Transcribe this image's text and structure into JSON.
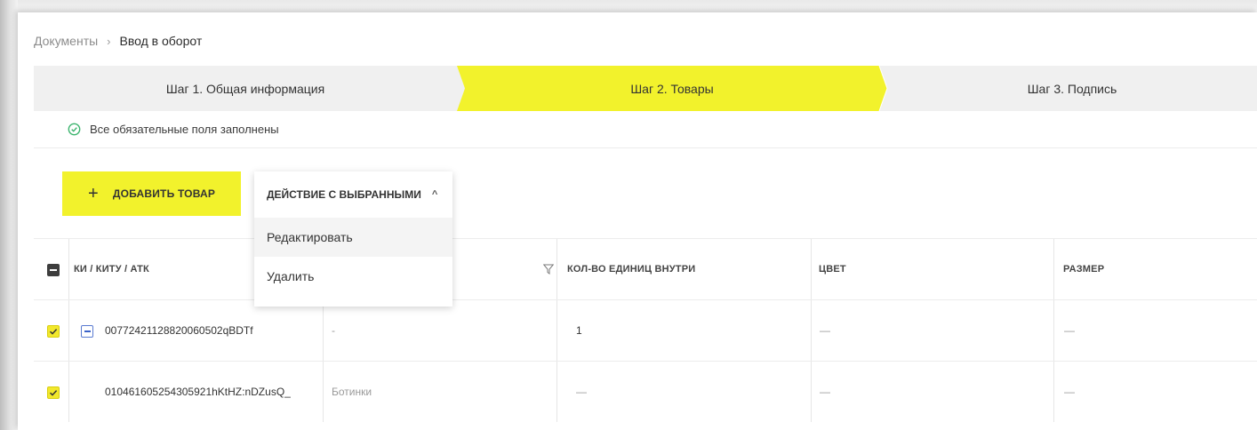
{
  "breadcrumb": {
    "root": "Документы",
    "separator": "›",
    "current": "Ввод в оборот"
  },
  "steps": [
    {
      "label": "Шаг 1. Общая информация",
      "active": false
    },
    {
      "label": "Шаг 2. Товары",
      "active": true
    },
    {
      "label": "Шаг 3. Подпись",
      "active": false
    }
  ],
  "status": {
    "text": "Все обязательные поля заполнены",
    "icon": "check-circle-icon"
  },
  "toolbar": {
    "add_label": "ДОБАВИТЬ ТОВАР",
    "add_icon": "+",
    "actions_label": "ДЕЙСТВИЕ С ВЫБРАННЫМИ",
    "actions_icon": "^"
  },
  "actions_menu": {
    "items": [
      "Редактировать",
      "Удалить"
    ]
  },
  "table": {
    "headers": [
      "КИ / КИТУ / АТК",
      "",
      "КОЛ-ВО ЕДИНИЦ ВНУТРИ",
      "ЦВЕТ",
      "РАЗМЕР"
    ],
    "rows": [
      {
        "selected": true,
        "expandable": true,
        "code": "00772421128820060502qBDTf",
        "name": "-",
        "qty": "1",
        "color": "—",
        "size": "—"
      },
      {
        "selected": true,
        "expandable": false,
        "code": "010461605254305921hKtHZ:nDZusQ_",
        "name": "Ботинки",
        "qty": "—",
        "color": "—",
        "size": "—"
      }
    ]
  },
  "colors": {
    "accent": "#f2f22c",
    "check": "#3cb46e",
    "step_bg": "#f0f0f0"
  }
}
